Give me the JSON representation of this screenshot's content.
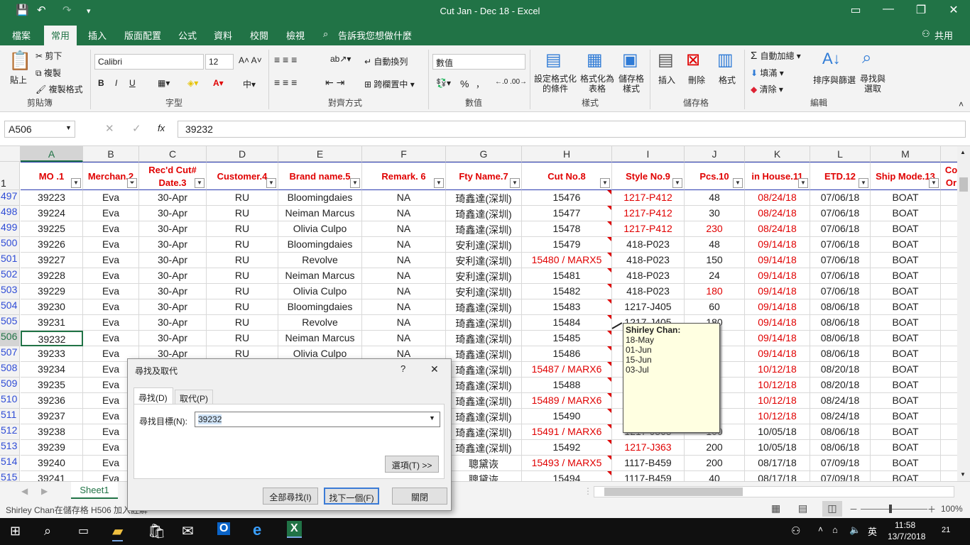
{
  "window": {
    "title": "Cut  Jan - Dec 18  -  Excel",
    "minimize": "—",
    "restore": "❐",
    "close": "✕",
    "ribbon_toggle": "▭"
  },
  "qat": {
    "save": "💾",
    "undo": "↶",
    "redo": "↷",
    "more": "▾"
  },
  "tabs": [
    "檔案",
    "常用",
    "插入",
    "版面配置",
    "公式",
    "資料",
    "校閱",
    "檢視"
  ],
  "tell_me": "告訴我您想做什麼",
  "share": "共用",
  "ribbon": {
    "clipboard": {
      "paste": "貼上",
      "cut": "剪下",
      "copy": "複製",
      "format_painter": "複製格式",
      "label": "剪貼簿"
    },
    "font": {
      "name": "Calibri",
      "size": "12",
      "bold": "B",
      "italic": "I",
      "underline": "U",
      "label": "字型"
    },
    "alignment": {
      "wrap": "自動換列",
      "merge": "跨欄置中",
      "label": "對齊方式"
    },
    "number": {
      "format": "數值",
      "percent": "%",
      "comma": "，",
      "label": "數值"
    },
    "styles": {
      "conditional": "設定格式化\n的條件",
      "table": "格式化為\n表格",
      "cell": "儲存格\n樣式",
      "label": "樣式"
    },
    "cells": {
      "insert": "插入",
      "delete": "刪除",
      "format": "格式",
      "label": "儲存格"
    },
    "editing": {
      "autosum": "自動加總",
      "fill": "填滿",
      "clear": "清除",
      "sort": "排序與篩選",
      "find": "尋找與\n選取",
      "label": "編輯"
    }
  },
  "formula_bar": {
    "name_box": "A506",
    "value": "39232",
    "fx": "fx",
    "cancel": "✕",
    "enter": "✓"
  },
  "columns": [
    "A",
    "B",
    "C",
    "D",
    "E",
    "F",
    "G",
    "H",
    "I",
    "J",
    "K",
    "L",
    "M"
  ],
  "header_row": {
    "num": "1",
    "cells": [
      "MO .1",
      "Merchan.2",
      "Rec'd Cut#\nDate.3",
      "Customer.4",
      "Brand name.5",
      "Remark. 6",
      "Fty Name.7",
      "Cut No.8",
      "Style No.9",
      "Pcs.10",
      "in House.11",
      "ETD.12",
      "Ship Mode.13",
      "Co\nOr"
    ]
  },
  "rows": [
    {
      "num": "497",
      "cells": [
        "39223",
        "Eva",
        "30-Apr",
        "RU",
        "Bloomingdaies",
        "NA",
        "琦鑫達(深圳)",
        "15476",
        "1217-P412",
        "48",
        "08/24/18",
        "07/06/18",
        "BOAT"
      ]
    },
    {
      "num": "498",
      "cells": [
        "39224",
        "Eva",
        "30-Apr",
        "RU",
        "Neiman Marcus",
        "NA",
        "琦鑫達(深圳)",
        "15477",
        "1217-P412",
        "30",
        "08/24/18",
        "07/06/18",
        "BOAT"
      ]
    },
    {
      "num": "499",
      "cells": [
        "39225",
        "Eva",
        "30-Apr",
        "RU",
        "Olivia Culpo",
        "NA",
        "琦鑫達(深圳)",
        "15478",
        "1217-P412",
        "230",
        "08/24/18",
        "07/06/18",
        "BOAT"
      ]
    },
    {
      "num": "500",
      "cells": [
        "39226",
        "Eva",
        "30-Apr",
        "RU",
        "Bloomingdaies",
        "NA",
        "安利達(深圳)",
        "15479",
        "418-P023",
        "48",
        "09/14/18",
        "07/06/18",
        "BOAT"
      ]
    },
    {
      "num": "501",
      "cells": [
        "39227",
        "Eva",
        "30-Apr",
        "RU",
        "Revolve",
        "NA",
        "安利達(深圳)",
        "15480 / MARX5",
        "418-P023",
        "150",
        "09/14/18",
        "07/06/18",
        "BOAT"
      ]
    },
    {
      "num": "502",
      "cells": [
        "39228",
        "Eva",
        "30-Apr",
        "RU",
        "Neiman Marcus",
        "NA",
        "安利達(深圳)",
        "15481",
        "418-P023",
        "24",
        "09/14/18",
        "07/06/18",
        "BOAT"
      ]
    },
    {
      "num": "503",
      "cells": [
        "39229",
        "Eva",
        "30-Apr",
        "RU",
        "Olivia Culpo",
        "NA",
        "安利達(深圳)",
        "15482",
        "418-P023",
        "180",
        "09/14/18",
        "07/06/18",
        "BOAT"
      ]
    },
    {
      "num": "504",
      "cells": [
        "39230",
        "Eva",
        "30-Apr",
        "RU",
        "Bloomingdaies",
        "NA",
        "琦鑫達(深圳)",
        "15483",
        "1217-J405",
        "60",
        "09/14/18",
        "08/06/18",
        "BOAT"
      ]
    },
    {
      "num": "505",
      "cells": [
        "39231",
        "Eva",
        "30-Apr",
        "RU",
        "Revolve",
        "NA",
        "琦鑫達(深圳)",
        "15484",
        "1217-J405",
        "180",
        "09/14/18",
        "08/06/18",
        "BOAT"
      ]
    },
    {
      "num": "506",
      "cells": [
        "39232",
        "Eva",
        "30-Apr",
        "RU",
        "Neiman Marcus",
        "NA",
        "琦鑫達(深圳)",
        "15485",
        "",
        "",
        "09/14/18",
        "08/06/18",
        "BOAT"
      ]
    },
    {
      "num": "507",
      "cells": [
        "39233",
        "Eva",
        "30-Apr",
        "RU",
        "Olivia Culpo",
        "NA",
        "琦鑫達(深圳)",
        "15486",
        "",
        "",
        "09/14/18",
        "08/06/18",
        "BOAT"
      ]
    },
    {
      "num": "508",
      "cells": [
        "39234",
        "Eva",
        "",
        "",
        "",
        "",
        "琦鑫達(深圳)",
        "15487 / MARX6",
        "",
        "",
        "10/12/18",
        "08/20/18",
        "BOAT"
      ]
    },
    {
      "num": "509",
      "cells": [
        "39235",
        "Eva",
        "",
        "",
        "",
        "",
        "琦鑫達(深圳)",
        "15488",
        "",
        "",
        "10/12/18",
        "08/20/18",
        "BOAT"
      ]
    },
    {
      "num": "510",
      "cells": [
        "39236",
        "Eva",
        "",
        "",
        "",
        "",
        "琦鑫達(深圳)",
        "15489 / MARX6",
        "",
        "",
        "10/12/18",
        "08/24/18",
        "BOAT"
      ]
    },
    {
      "num": "511",
      "cells": [
        "39237",
        "Eva",
        "",
        "",
        "",
        "",
        "琦鑫達(深圳)",
        "15490",
        "",
        "",
        "10/12/18",
        "08/24/18",
        "BOAT"
      ]
    },
    {
      "num": "512",
      "cells": [
        "39238",
        "Eva",
        "",
        "",
        "",
        "",
        "琦鑫達(深圳)",
        "15491 / MARX6",
        "1217-J363",
        "100",
        "10/05/18",
        "08/06/18",
        "BOAT"
      ]
    },
    {
      "num": "513",
      "cells": [
        "39239",
        "Eva",
        "",
        "",
        "",
        "",
        "琦鑫達(深圳)",
        "15492",
        "1217-J363",
        "200",
        "10/05/18",
        "08/06/18",
        "BOAT"
      ]
    },
    {
      "num": "514",
      "cells": [
        "39240",
        "Eva",
        "",
        "",
        "",
        "",
        "聰黛诙",
        "15493 / MARX5",
        "1117-B459",
        "200",
        "08/17/18",
        "07/09/18",
        "BOAT"
      ]
    },
    {
      "num": "515",
      "cells": [
        "39241",
        "Eva",
        "",
        "",
        "",
        "",
        "聰黛诙",
        "15494",
        "1117-B459",
        "40",
        "08/17/18",
        "07/09/18",
        "BOAT"
      ]
    }
  ],
  "comment": {
    "author": "Shirley Chan:",
    "lines": [
      "18-May",
      "01-Jun",
      "15-Jun",
      "03-Jul"
    ]
  },
  "sheet_tab": "Sheet1",
  "status": {
    "text": "Shirley Chan在儲存格 H506 加入註解",
    "zoom": "100%",
    "minus": "－",
    "plus": "＋"
  },
  "dialog": {
    "title": "尋找及取代",
    "help": "?",
    "close": "✕",
    "tab_find": "尋找(D)",
    "tab_replace": "取代(P)",
    "find_label": "尋找目標(N):",
    "find_value": "39232",
    "options": "選項(T) >>",
    "find_all": "全部尋找(I)",
    "find_next": "找下一個(F)",
    "close_btn": "關閉"
  },
  "taskbar": {
    "time": "11:58",
    "date": "13/7/2018",
    "lang": "英",
    "notif": "21"
  },
  "colors": {
    "excel_green": "#217346",
    "red": "#e00000",
    "blue": "#2f4cd6"
  }
}
